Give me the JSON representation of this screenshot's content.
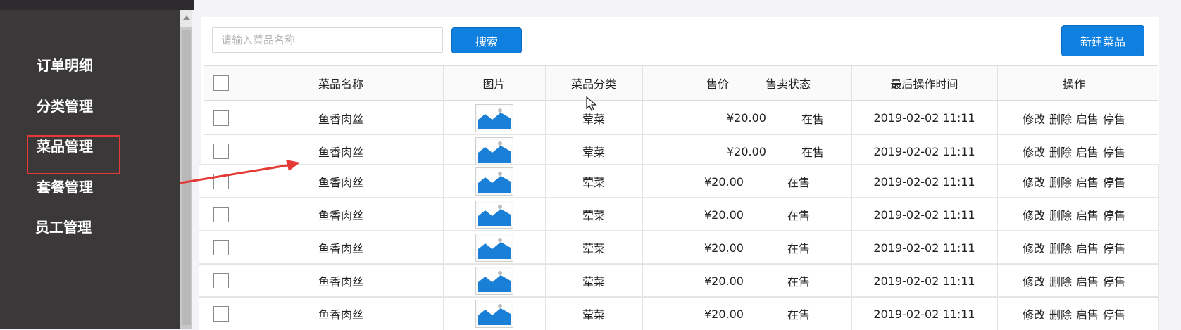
{
  "sidebar": {
    "items": [
      {
        "label": "订单明细"
      },
      {
        "label": "分类管理"
      },
      {
        "label": "菜品管理"
      },
      {
        "label": "套餐管理"
      },
      {
        "label": "员工管理"
      }
    ]
  },
  "toolbar": {
    "search_placeholder": "请输入菜品名称",
    "search_label": "搜索",
    "new_label": "新建菜品"
  },
  "table": {
    "headers": {
      "name": "菜品名称",
      "image": "图片",
      "category": "菜品分类",
      "price": "售价",
      "status": "售卖状态",
      "time": "最后操作时间",
      "actions": "操作"
    },
    "rows": [
      {
        "name": "鱼香肉丝",
        "category": "荤菜",
        "price": "¥20.00",
        "status": "在售",
        "time": "2019-02-02 11:11"
      },
      {
        "name": "鱼香肉丝",
        "category": "荤菜",
        "price": "¥20.00",
        "status": "在售",
        "time": "2019-02-02 11:11"
      },
      {
        "name": "鱼香肉丝",
        "category": "荤菜",
        "price": "¥20.00",
        "status": "在售",
        "time": "2019-02-02 11:11"
      },
      {
        "name": "鱼香肉丝",
        "category": "荤菜",
        "price": "¥20.00",
        "status": "在售",
        "time": "2019-02-02 11:11"
      },
      {
        "name": "鱼香肉丝",
        "category": "荤菜",
        "price": "¥20.00",
        "status": "在售",
        "time": "2019-02-02 11:11"
      },
      {
        "name": "鱼香肉丝",
        "category": "荤菜",
        "price": "¥20.00",
        "status": "在售",
        "time": "2019-02-02 11:11"
      },
      {
        "name": "鱼香肉丝",
        "category": "荤菜",
        "price": "¥20.00",
        "status": "在售",
        "time": "2019-02-02 11:11"
      }
    ],
    "row_actions": [
      "修改",
      "删除",
      "启售",
      "停售"
    ]
  },
  "colors": {
    "sidebar_bg": "#3a3839",
    "accent": "#0f7fe0",
    "annotation_red": "#e53935",
    "image_placeholder": "#1a7fd6"
  },
  "icons": [
    "image-placeholder-icon",
    "checkbox-icon",
    "scroll-up-arrow-icon",
    "mouse-cursor-icon"
  ]
}
